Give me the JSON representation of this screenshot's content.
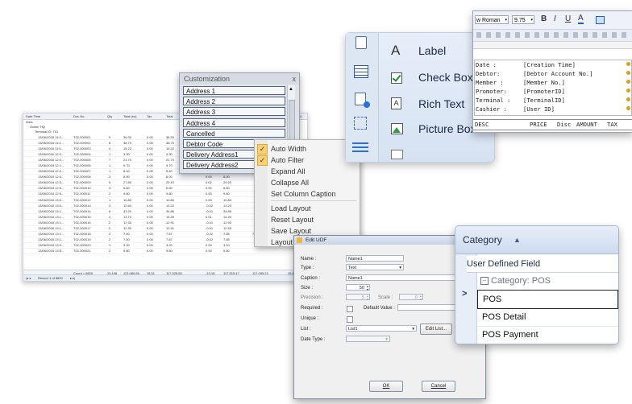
{
  "grid": {
    "columns": [
      "Date Time",
      "Doc No.",
      "Qty",
      "Total (ex)",
      "Tax",
      "Total"
    ],
    "col_extra": "Card",
    "group1": "Outlet: HQ",
    "group2": "Terminal ID: T01",
    "area_label": "Area",
    "rows": [
      [
        "13/06/2018 11:3...",
        "T02-000001",
        "9",
        "36.30",
        "0.00",
        "36.30",
        "0.00",
        "36.30"
      ],
      [
        "13/06/2018 11:4...",
        "T02-000002",
        "6",
        "38.70",
        "0.00",
        "38.70",
        "0.00",
        "38.70"
      ],
      [
        "13/06/2018 11:5...",
        "T02-000003",
        "4",
        "15.22",
        "0.00",
        "15.22",
        "0.00",
        "15.22"
      ],
      [
        "13/06/2018 12:0...",
        "T02-000004",
        "1",
        "3.30",
        "0.00",
        "3.30",
        "0.00",
        "3.30"
      ],
      [
        "13/06/2018 12:0...",
        "T02-000005",
        "7",
        "21.70",
        "0.00",
        "21.70",
        "0.00",
        "21.70"
      ],
      [
        "13/06/2018 12:1...",
        "T02-000006",
        "1",
        "9.70",
        "0.00",
        "9.70",
        "0.00",
        "9.70"
      ],
      [
        "13/06/2018 12:2...",
        "T02-000007",
        "1",
        "8.40",
        "0.00",
        "8.40",
        "0.00",
        "8.40"
      ],
      [
        "13/06/2018 12:5...",
        "T02-000008",
        "3",
        "8.00",
        "0.00",
        "8.00",
        "0.00",
        "8.00"
      ],
      [
        "13/06/2018 12:5...",
        "T02-000009",
        "5",
        "27.80",
        "0.00",
        "29.10",
        "0.02",
        "29.20"
      ],
      [
        "13/06/2018 12:5...",
        "T02-000010",
        "3",
        "6.60",
        "0.00",
        "6.60",
        "0.00",
        "6.60"
      ],
      [
        "13/06/2018 12:5...",
        "T02-000011",
        "2",
        "9.80",
        "0.00",
        "9.80",
        "0.00",
        "9.80"
      ],
      [
        "13/06/2018 13:0...",
        "T02-000012",
        "1",
        "10.80",
        "0.00",
        "10.80",
        "0.00",
        "10.80"
      ],
      [
        "13/06/2018 13:0...",
        "T02-000013",
        "3",
        "12.60",
        "0.00",
        "13.22",
        "-0.02",
        "13.20"
      ],
      [
        "13/06/2018 13:1...",
        "T02-000014",
        "6",
        "33.20",
        "0.00",
        "34.86",
        "-0.01",
        "34.85"
      ],
      [
        "13/06/2018 13:1...",
        "T02-000015",
        "4",
        "13.70",
        "0.00",
        "14.39",
        "0.01",
        "14.40"
      ],
      [
        "13/06/2018 13:1...",
        "T02-000016",
        "2",
        "12.30",
        "0.00",
        "12.91",
        "-0.01",
        "12.90"
      ],
      [
        "13/06/2018 13:1...",
        "T02-000017",
        "2",
        "12.30",
        "0.00",
        "12.91",
        "-0.01",
        "12.90"
      ],
      [
        "13/06/2018 13:1...",
        "T02-000018",
        "2",
        "7.50",
        "0.00",
        "7.87",
        "-0.02",
        "7.85"
      ],
      [
        "13/06/2018 13:1...",
        "T02-000019",
        "2",
        "7.50",
        "0.00",
        "7.87",
        "-0.02",
        "7.85"
      ],
      [
        "13/06/2018 13:3...",
        "T02-000020",
        "1",
        "3.20",
        "0.00",
        "3.20",
        "0.00",
        "3.20"
      ],
      [
        "13/06/2018 13:5...",
        "T02-000021",
        "2",
        "9.80",
        "0.00",
        "9.80",
        "0.00",
        "9.80"
      ]
    ],
    "extra_vals": [
      "7.85",
      "0.00",
      "7.85"
    ],
    "footer": [
      "Count = 8820",
      "23,196",
      "113,080.95",
      "16.51",
      "117,528.65",
      "-13.18",
      "117,515.47",
      "117,095.22",
      "15.65"
    ],
    "nav_record": "Record 1 of 8820"
  },
  "customization": {
    "title": "Customization",
    "close": "x",
    "items": [
      "Address 1",
      "Address 2",
      "Address 3",
      "Address 4",
      "Cancelled",
      "Debtor Code",
      "Delivery Address1",
      "Delivery Address2"
    ]
  },
  "menu": {
    "items": [
      {
        "label": "Auto Width",
        "checked": true
      },
      {
        "label": "Auto Filter",
        "checked": true
      },
      {
        "label": "Expand All",
        "checked": false
      },
      {
        "label": "Collapse All",
        "checked": false
      },
      {
        "label": "Set Column Caption",
        "checked": false
      },
      {
        "label": "Load Layout",
        "checked": false
      },
      {
        "label": "Reset Layout",
        "checked": false
      },
      {
        "label": "Save Layout",
        "checked": false
      },
      {
        "label": "Layout",
        "checked": false
      }
    ],
    "check_glyph": "✓"
  },
  "toolbox": {
    "items": [
      "Label",
      "Check Box",
      "Rich Text",
      "Picture Box"
    ],
    "label_glyph": "A"
  },
  "report": {
    "font": "w Roman",
    "size": "9.75",
    "bold": "B",
    "italic": "I",
    "underline": "U",
    "fields": [
      [
        "Date :",
        "[Creation Time]"
      ],
      [
        "Debtor:",
        "[Debtor Account No.]"
      ],
      [
        "Member :",
        "[Member No.]"
      ],
      [
        "Promoter:",
        "[PromoterID]"
      ],
      [
        "Terminal :",
        "[TerminalID]"
      ],
      [
        "Cashier :",
        "[User ID]"
      ]
    ],
    "footer_cols": [
      "DESC",
      "PRICE",
      "Disc",
      "AMOUNT",
      "TAX"
    ]
  },
  "udf": {
    "title": "Edit UDF",
    "labels": {
      "name": "Name :",
      "type": "Type :",
      "caption": "Caption :",
      "size": "Size :",
      "precision": "Precision :",
      "scale": "Scale :",
      "required": "Required :",
      "default_value": "Default Value :",
      "unique": "Unique :",
      "list": "List :",
      "date_type": "Date Type :"
    },
    "values": {
      "name": "Name1",
      "type": "Text",
      "caption": "Name1",
      "size": "50",
      "precision": "5",
      "scale": "0",
      "list": "List1"
    },
    "edit_list": "Edit List...",
    "ok": "OK",
    "cancel": "Cancel"
  },
  "category": {
    "header": "Category",
    "sub": "User Defined Field",
    "group": "Category: POS",
    "items": [
      "POS",
      "POS Detail",
      "POS Payment"
    ]
  }
}
